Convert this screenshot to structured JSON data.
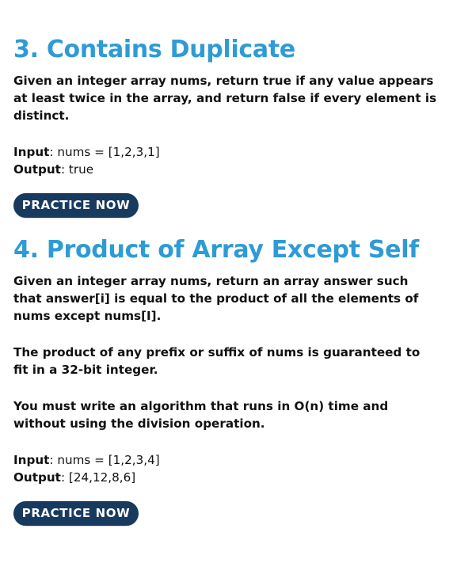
{
  "accent_color": "#2e9bd6",
  "button_color": "#173a5e",
  "sections": [
    {
      "title": "3. Contains Duplicate",
      "paragraphs": [
        "Given an integer array nums, return true if any value appears at least twice in the array, and return false if every element is distinct."
      ],
      "input_label": "Input",
      "input_value": "nums = [1,2,3,1]",
      "output_label": "Output",
      "output_value": "true",
      "button_label": "PRACTICE NOW"
    },
    {
      "title": "4. Product of Array Except Self",
      "paragraphs": [
        "Given an integer array nums, return an array answer such that answer[i] is equal to the product of all the elements of nums except nums[I].",
        "The product of any prefix or suffix of nums is guaranteed to fit in a 32-bit integer.",
        "You must write an algorithm that runs in O(n) time and without using the division operation."
      ],
      "input_label": "Input",
      "input_value": "nums = [1,2,3,4]",
      "output_label": "Output",
      "output_value": "[24,12,8,6]",
      "button_label": "PRACTICE NOW"
    }
  ]
}
